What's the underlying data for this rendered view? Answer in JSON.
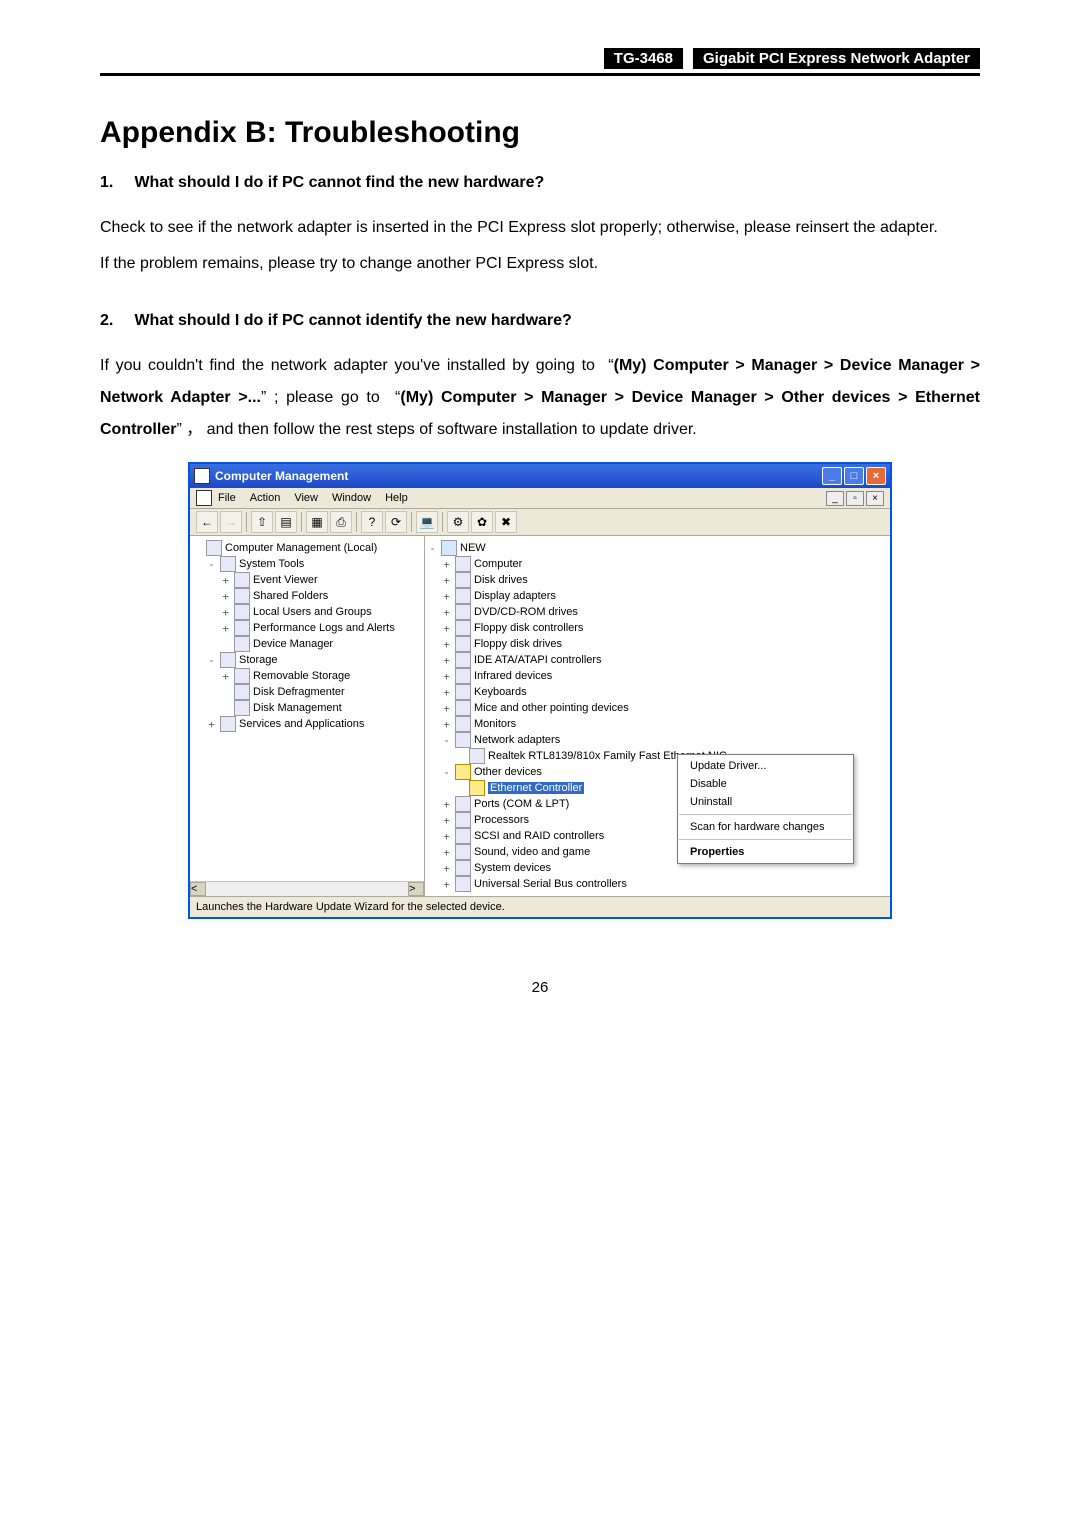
{
  "header": {
    "model": "TG-3468",
    "product": "Gigabit PCI Express Network Adapter"
  },
  "title": "Appendix B: Troubleshooting",
  "q1": {
    "num": "1.",
    "heading": "What should I do if PC cannot find the new hardware?",
    "p1": "Check to see if the network adapter is inserted in the PCI Express slot properly; otherwise, please reinsert the adapter.",
    "p2": "If the problem remains, please try to change another PCI Express slot."
  },
  "q2": {
    "num": "2.",
    "heading": "What should I do if PC cannot identify the new hardware?",
    "p1a": "If you couldn't find the network adapter you've installed by going to  “",
    "p1b": "(My) Computer > Manager > Device Manager > Network Adapter >...",
    "p1c": "” ; please go to  “",
    "p1d": "(My) Computer > Manager > Device Manager > Other devices > Ethernet Controller",
    "p1e": "” ， and then follow the rest steps of software installation to update driver."
  },
  "cm": {
    "title": "Computer Management",
    "menus": [
      "File",
      "Action",
      "View",
      "Window",
      "Help"
    ],
    "left_tree": [
      {
        "lvl": 0,
        "exp": "",
        "label": "Computer Management (Local)"
      },
      {
        "lvl": 1,
        "exp": "-",
        "label": "System Tools"
      },
      {
        "lvl": 2,
        "exp": "+",
        "label": "Event Viewer"
      },
      {
        "lvl": 2,
        "exp": "+",
        "label": "Shared Folders"
      },
      {
        "lvl": 2,
        "exp": "+",
        "label": "Local Users and Groups"
      },
      {
        "lvl": 2,
        "exp": "+",
        "label": "Performance Logs and Alerts"
      },
      {
        "lvl": 2,
        "exp": "",
        "label": "Device Manager"
      },
      {
        "lvl": 1,
        "exp": "-",
        "label": "Storage"
      },
      {
        "lvl": 2,
        "exp": "+",
        "label": "Removable Storage"
      },
      {
        "lvl": 2,
        "exp": "",
        "label": "Disk Defragmenter"
      },
      {
        "lvl": 2,
        "exp": "",
        "label": "Disk Management"
      },
      {
        "lvl": 1,
        "exp": "+",
        "label": "Services and Applications"
      }
    ],
    "right_root": "NEW",
    "right_tree": [
      {
        "exp": "+",
        "label": "Computer"
      },
      {
        "exp": "+",
        "label": "Disk drives"
      },
      {
        "exp": "+",
        "label": "Display adapters"
      },
      {
        "exp": "+",
        "label": "DVD/CD-ROM drives"
      },
      {
        "exp": "+",
        "label": "Floppy disk controllers"
      },
      {
        "exp": "+",
        "label": "Floppy disk drives"
      },
      {
        "exp": "+",
        "label": "IDE ATA/ATAPI controllers"
      },
      {
        "exp": "+",
        "label": "Infrared devices"
      },
      {
        "exp": "+",
        "label": "Keyboards"
      },
      {
        "exp": "+",
        "label": "Mice and other pointing devices"
      },
      {
        "exp": "+",
        "label": "Monitors"
      },
      {
        "exp": "-",
        "label": "Network adapters"
      }
    ],
    "net_adapter_child": "Realtek RTL8139/810x Family Fast Ethernet NIC",
    "other_devices": "Other devices",
    "ethernet_controller": "Ethernet Controller",
    "right_tree_tail": [
      {
        "exp": "+",
        "label": "Ports (COM & LPT)"
      },
      {
        "exp": "+",
        "label": "Processors"
      },
      {
        "exp": "+",
        "label": "SCSI and RAID controllers"
      },
      {
        "exp": "+",
        "label": "Sound, video and game"
      },
      {
        "exp": "+",
        "label": "System devices"
      },
      {
        "exp": "+",
        "label": "Universal Serial Bus controllers"
      }
    ],
    "context_menu": [
      "Update Driver...",
      "Disable",
      "Uninstall",
      "Scan for hardware changes",
      "Properties"
    ],
    "status": "Launches the Hardware Update Wizard for the selected device."
  },
  "page_number": "26"
}
